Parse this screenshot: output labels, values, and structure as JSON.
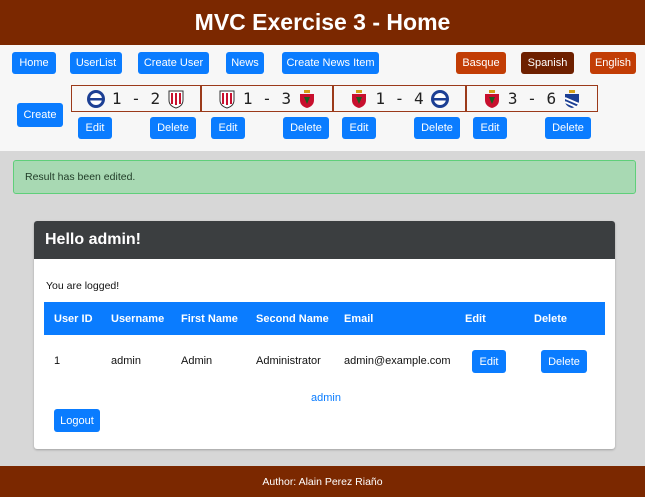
{
  "header": {
    "title": "MVC Exercise 3 - Home"
  },
  "nav": {
    "home": "Home",
    "userlist": "UserList",
    "create_user": "Create User",
    "news": "News",
    "create_news": "Create News Item",
    "basque": "Basque",
    "spanish": "Spanish",
    "english": "English"
  },
  "results": {
    "create_label": "Create",
    "edit_label": "Edit",
    "delete_label": "Delete",
    "matches": [
      {
        "home_crest": "alaves-crest-icon",
        "score": "1 - 2",
        "away_crest": "athletic-crest-icon"
      },
      {
        "home_crest": "athletic-crest-icon",
        "score": "1 - 3",
        "away_crest": "osasuna-crest-icon"
      },
      {
        "home_crest": "osasuna-crest-icon",
        "score": "1 - 4",
        "away_crest": "alaves-crest-icon"
      },
      {
        "home_crest": "osasuna-crest-icon",
        "score": "3 - 6",
        "away_crest": "real-sociedad-crest-icon"
      }
    ]
  },
  "alert": {
    "message": "Result has been edited."
  },
  "card": {
    "greeting": "Hello admin!",
    "status": "You are logged!",
    "table": {
      "headers": [
        "User ID",
        "Username",
        "First Name",
        "Second Name",
        "Email",
        "Edit",
        "Delete"
      ],
      "row": {
        "id": "1",
        "username": "admin",
        "first_name": "Admin",
        "second_name": "Administrator",
        "email": "admin@example.com"
      },
      "edit_label": "Edit",
      "delete_label": "Delete"
    },
    "user_link": "admin",
    "logout": "Logout"
  },
  "footer": {
    "author": "Author: Alain Perez Riaño"
  },
  "colors": {
    "brand": "#7b2800",
    "primary": "#0a7cff",
    "success_bg": "#a8d9b3",
    "dark_header": "#3b3e40"
  }
}
